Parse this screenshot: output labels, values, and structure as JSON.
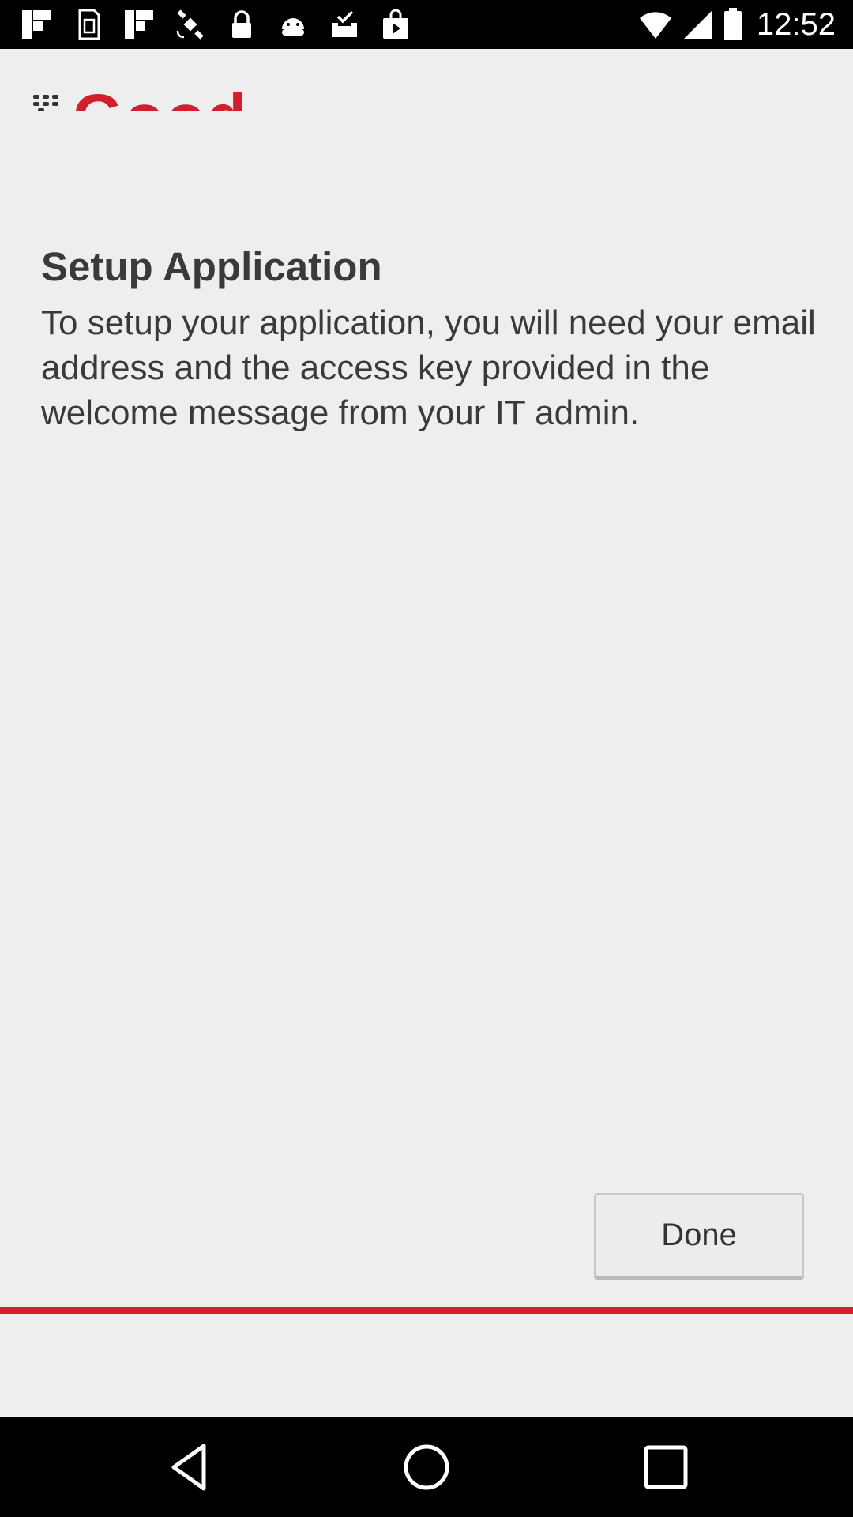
{
  "status_bar": {
    "time": "12:52",
    "left_icons": [
      "flipboard-icon",
      "sim-card-icon",
      "flipboard-icon",
      "fake-gps-satellite-icon",
      "lock-icon",
      "android-icon",
      "download-done-icon",
      "shopping-bag-icon"
    ],
    "right_icons": [
      "wifi-icon",
      "signal-icon",
      "battery-icon"
    ]
  },
  "app": {
    "logo_text": "Good",
    "title": "Setup Application",
    "message": "To setup your application, you will need your email address and the access key provided in the welcome message from your IT admin.",
    "done_label": "Done"
  },
  "colors": {
    "brand_red": "#d21f2b",
    "background": "#eeeeee",
    "text": "#3a3a3a"
  },
  "nav_bar": {
    "buttons": [
      "back-icon",
      "home-icon",
      "recents-icon"
    ]
  }
}
